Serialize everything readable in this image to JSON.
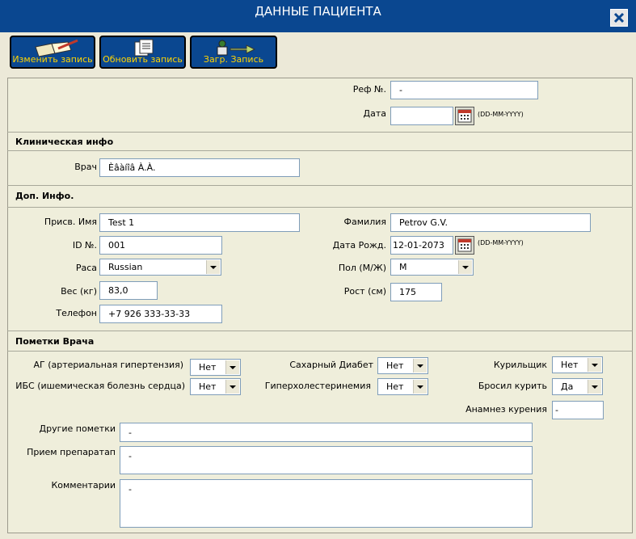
{
  "window": {
    "title": "ДАННЫЕ ПАЦИЕНТА"
  },
  "toolbar": {
    "edit_label": "Изменить запись",
    "update_label": "Обновить запись",
    "load_label": "Загр. Запись"
  },
  "header": {
    "ref_label": "Реф №.",
    "ref_value": "-",
    "date_label": "Дата",
    "date_value": "",
    "date_hint": "(DD-MM-YYYY)"
  },
  "clinical": {
    "title": "Клиническая инфо",
    "doctor_label": "Врач",
    "doctor_value": "Èâàíîâ À.À."
  },
  "extra": {
    "title": "Доп. Инфо.",
    "first_name_label": "Присв. Имя",
    "first_name_value": "Test 1",
    "last_name_label": "Фамилия",
    "last_name_value": "Petrov G.V.",
    "id_label": "ID №.",
    "id_value": "001",
    "dob_label": "Дата Рожд.",
    "dob_value": "12-01-2073",
    "dob_hint": "(DD-MM-YYYY)",
    "race_label": "Раса",
    "race_value": "Russian",
    "sex_label": "Пол (М/Ж)",
    "sex_value": "М",
    "weight_label": "Вес (кг)",
    "weight_value": "83,0",
    "height_label": "Рост (см)",
    "height_value": "175",
    "phone_label": "Телефон",
    "phone_value": "+7 926 333-33-33"
  },
  "notes": {
    "title": "Пометки Врача",
    "hypertension_label": "АГ (артериальная гипертензия)",
    "hypertension_value": "Нет",
    "diabetes_label": "Сахарный Диабет",
    "diabetes_value": "Нет",
    "smoker_label": "Курильщик",
    "smoker_value": "Нет",
    "ihd_label": "ИБС (ишемическая болезнь сердца)",
    "ihd_value": "Нет",
    "cholesterol_label": "Гиперхолестеринемия",
    "cholesterol_value": "Нет",
    "quit_label": "Бросил курить",
    "quit_value": "Да",
    "smoking_history_label": "Анамнез курения",
    "smoking_history_value": "-",
    "other_label": "Другие пометки",
    "other_value": "-",
    "meds_label": "Прием препаратап",
    "meds_value": "-",
    "comments_label": "Комментарии",
    "comments_value": "-"
  },
  "colors": {
    "title_bar": "#0a4790",
    "button_label": "#ffd400",
    "panel": "#efeedb"
  }
}
